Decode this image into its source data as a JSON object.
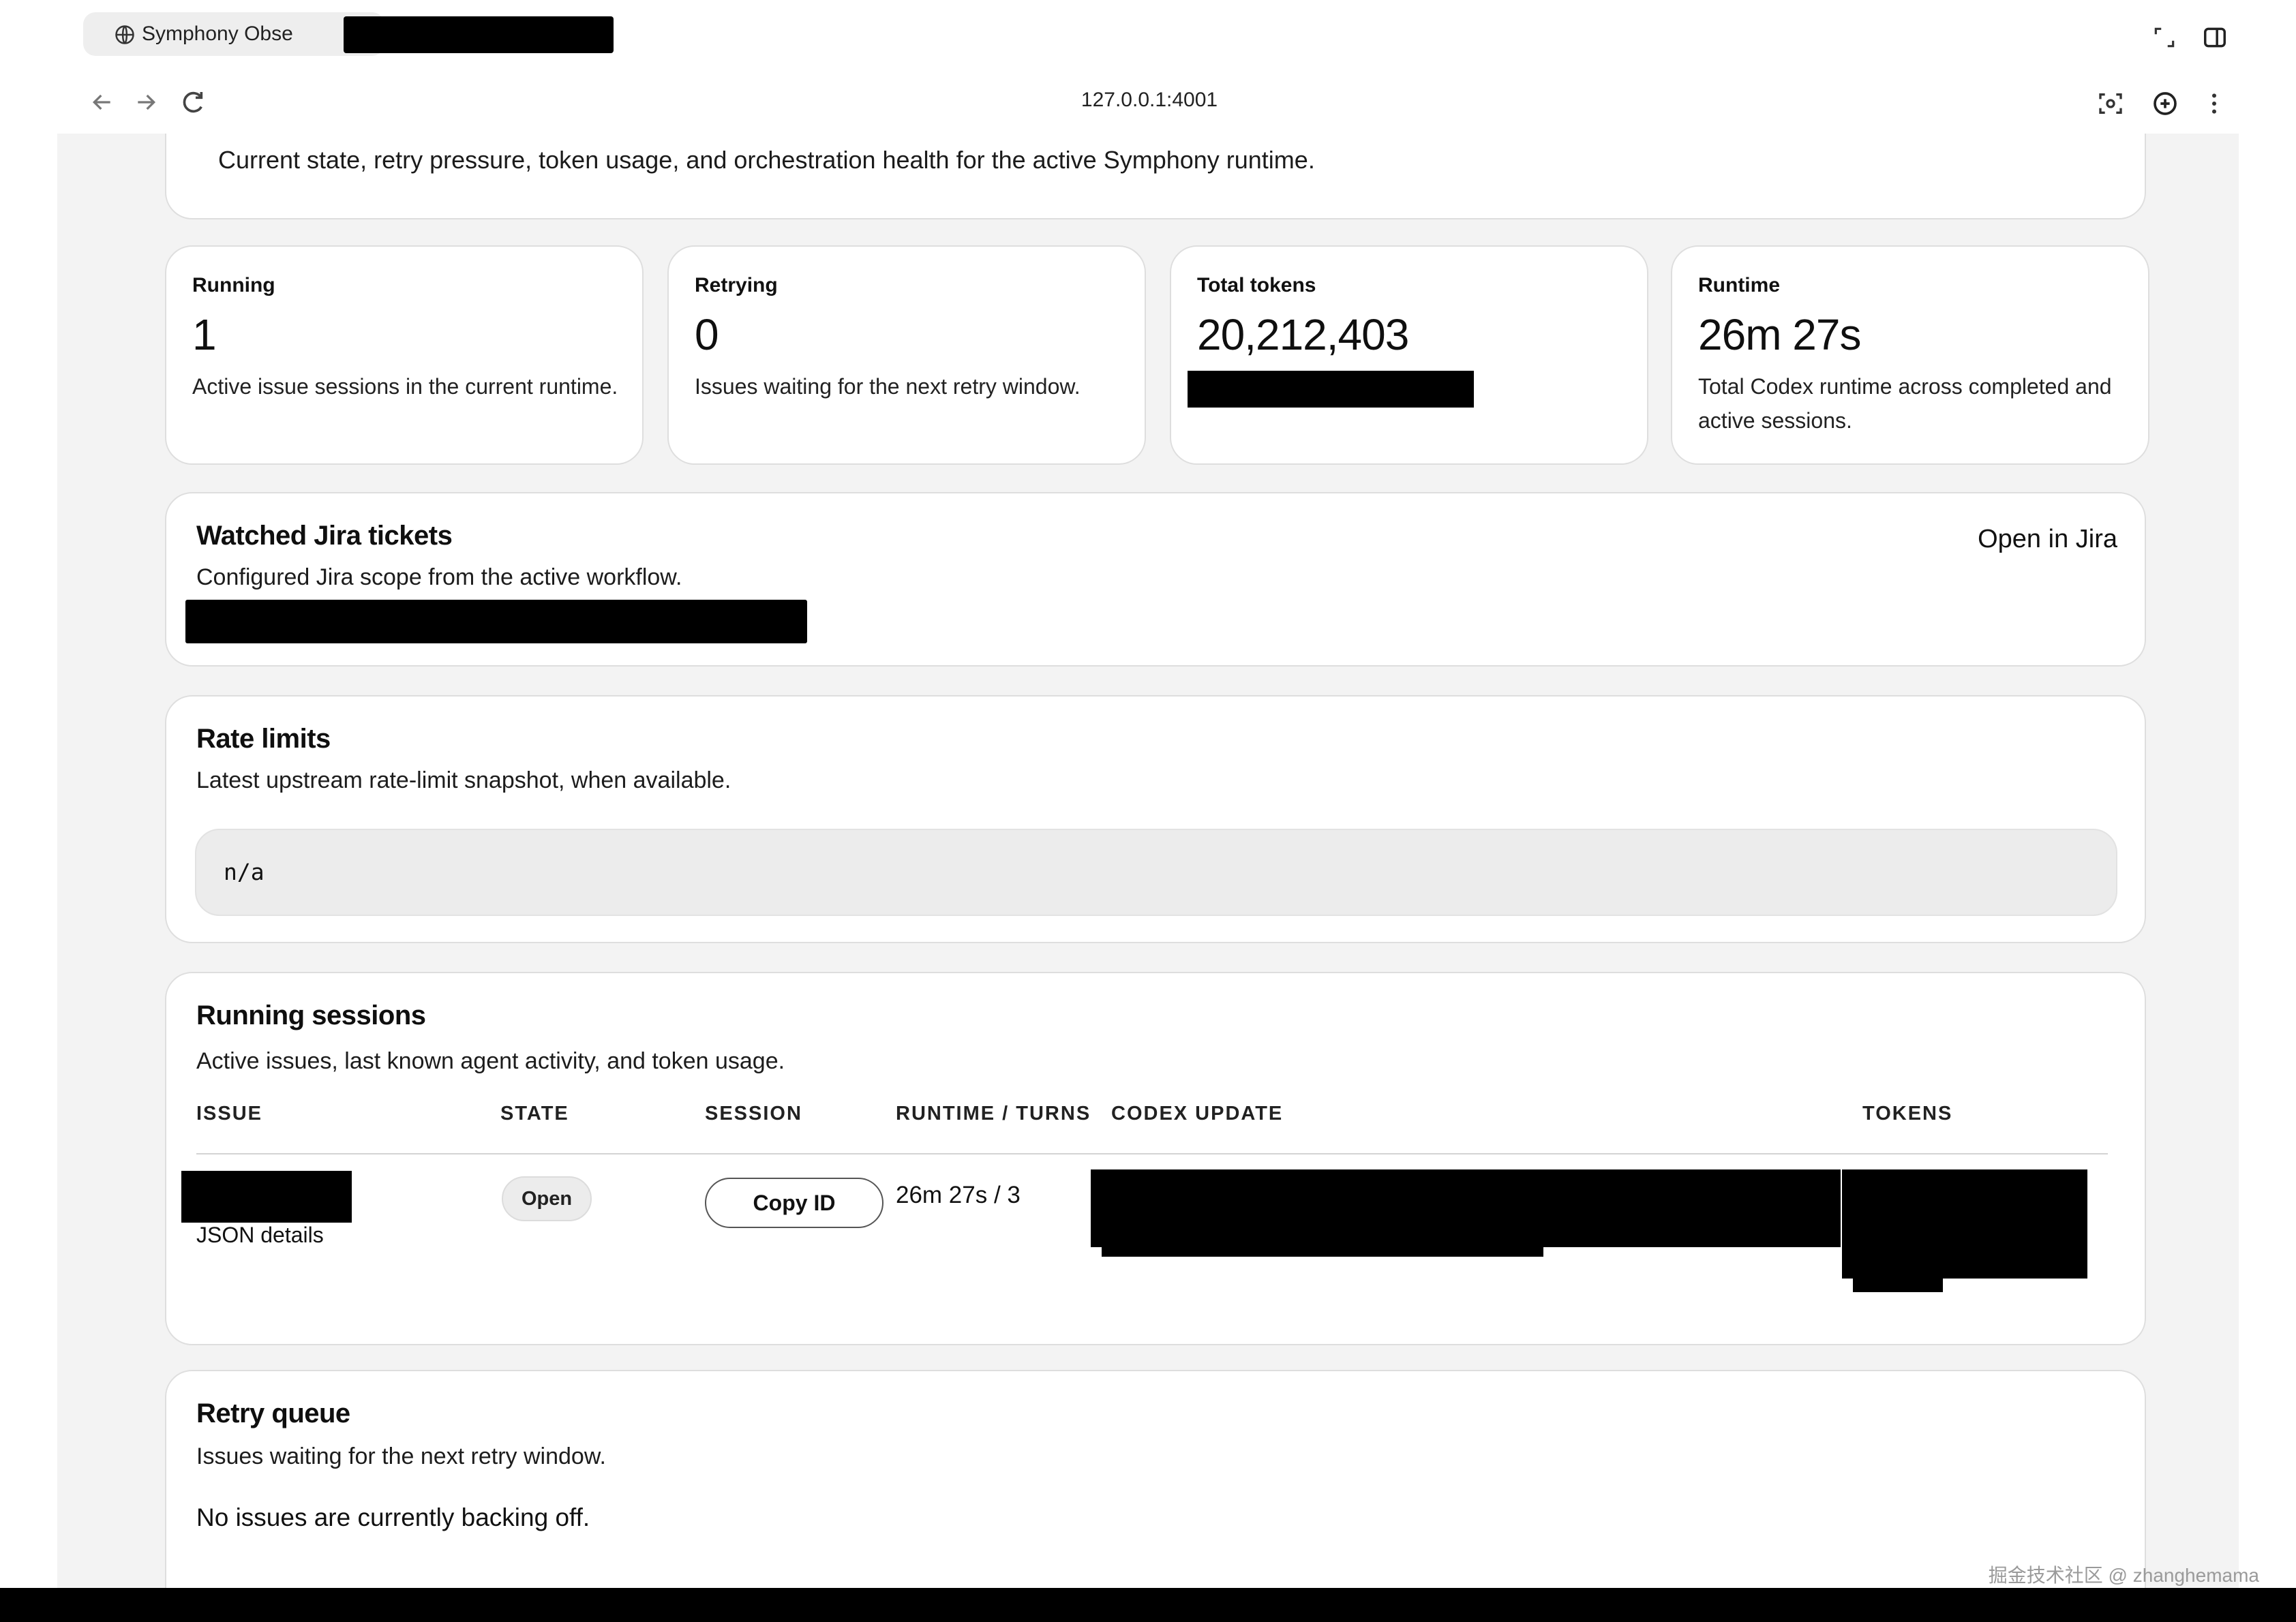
{
  "browser": {
    "tab_title": "Symphony Obse",
    "url": "127.0.0.1:4001"
  },
  "header": {
    "subtitle": "Current state, retry pressure, token usage, and orchestration health for the active Symphony runtime."
  },
  "metrics": [
    {
      "label": "Running",
      "value": "1",
      "description": "Active issue sessions in the current runtime."
    },
    {
      "label": "Retrying",
      "value": "0",
      "description": "Issues waiting for the next retry window."
    },
    {
      "label": "Total tokens",
      "value": "20,212,403",
      "description": ""
    },
    {
      "label": "Runtime",
      "value": "26m 27s",
      "description": "Total Codex runtime across completed and active sessions."
    }
  ],
  "jira": {
    "title": "Watched Jira tickets",
    "description": "Configured Jira scope from the active workflow.",
    "link_label": "Open in Jira"
  },
  "rate_limits": {
    "title": "Rate limits",
    "description": "Latest upstream rate-limit snapshot, when available.",
    "value": "n/a"
  },
  "running_sessions": {
    "title": "Running sessions",
    "description": "Active issues, last known agent activity, and token usage.",
    "columns": [
      "ISSUE",
      "STATE",
      "SESSION",
      "RUNTIME / TURNS",
      "CODEX UPDATE",
      "TOKENS"
    ],
    "rows": [
      {
        "json_link": "JSON details",
        "state": "Open",
        "session_button": "Copy ID",
        "runtime_turns": "26m 27s / 3"
      }
    ]
  },
  "retry_queue": {
    "title": "Retry queue",
    "description": "Issues waiting for the next retry window.",
    "empty_message": "No issues are currently backing off."
  },
  "watermark": "掘金技术社区 @ zhanghemama"
}
